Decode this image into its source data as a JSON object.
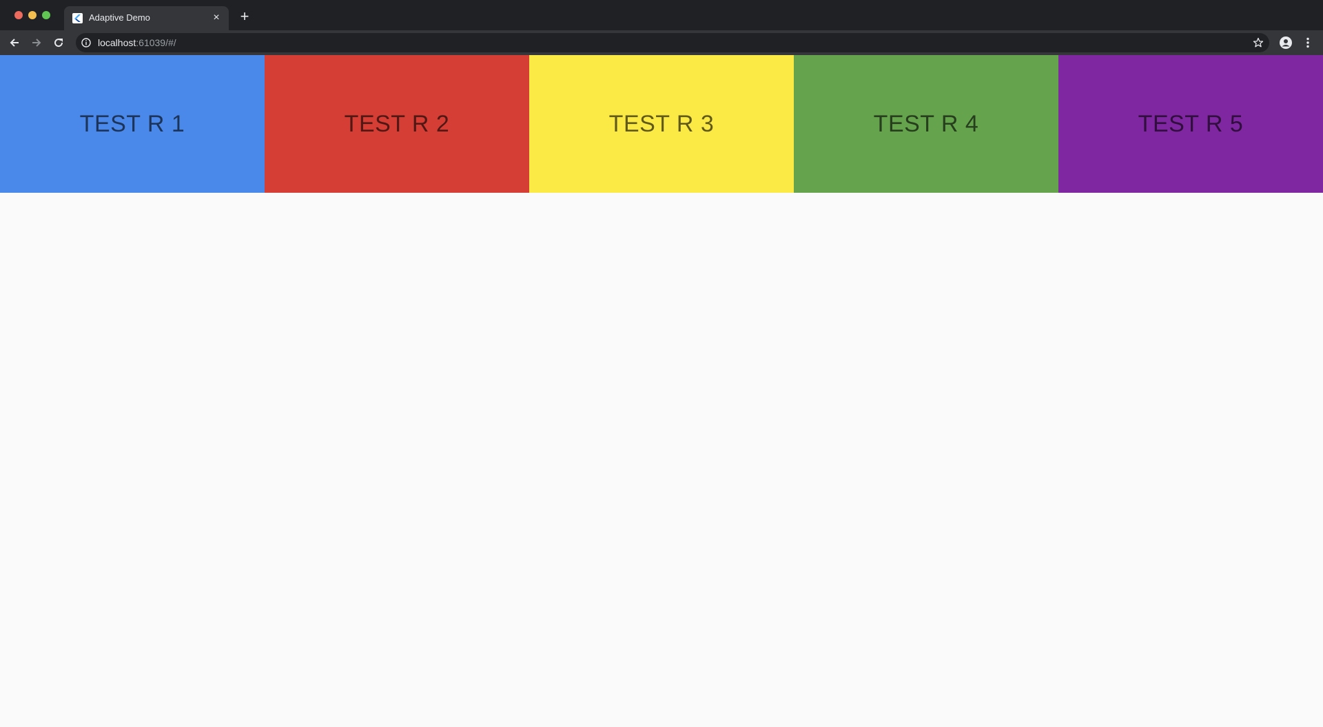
{
  "browser": {
    "tab_title": "Adaptive Demo",
    "tab_close_glyph": "×",
    "new_tab_glyph": "+",
    "url_host": "localhost",
    "url_rest": ":61039/#/",
    "icons": [
      "back-arrow-icon",
      "forward-arrow-icon",
      "reload-icon",
      "info-icon",
      "star-icon",
      "profile-icon",
      "more-vert-icon"
    ]
  },
  "tiles": [
    {
      "label": "TEST R 1",
      "color": "#4a89ea"
    },
    {
      "label": "TEST R 2",
      "color": "#d43e35"
    },
    {
      "label": "TEST R 3",
      "color": "#fbea46"
    },
    {
      "label": "TEST R 4",
      "color": "#65a44c"
    },
    {
      "label": "TEST R 5",
      "color": "#7f27a0"
    }
  ],
  "colors": {
    "page_background": "#fafafa",
    "chrome_dark": "#202124",
    "chrome_toolbar": "#35363a"
  }
}
